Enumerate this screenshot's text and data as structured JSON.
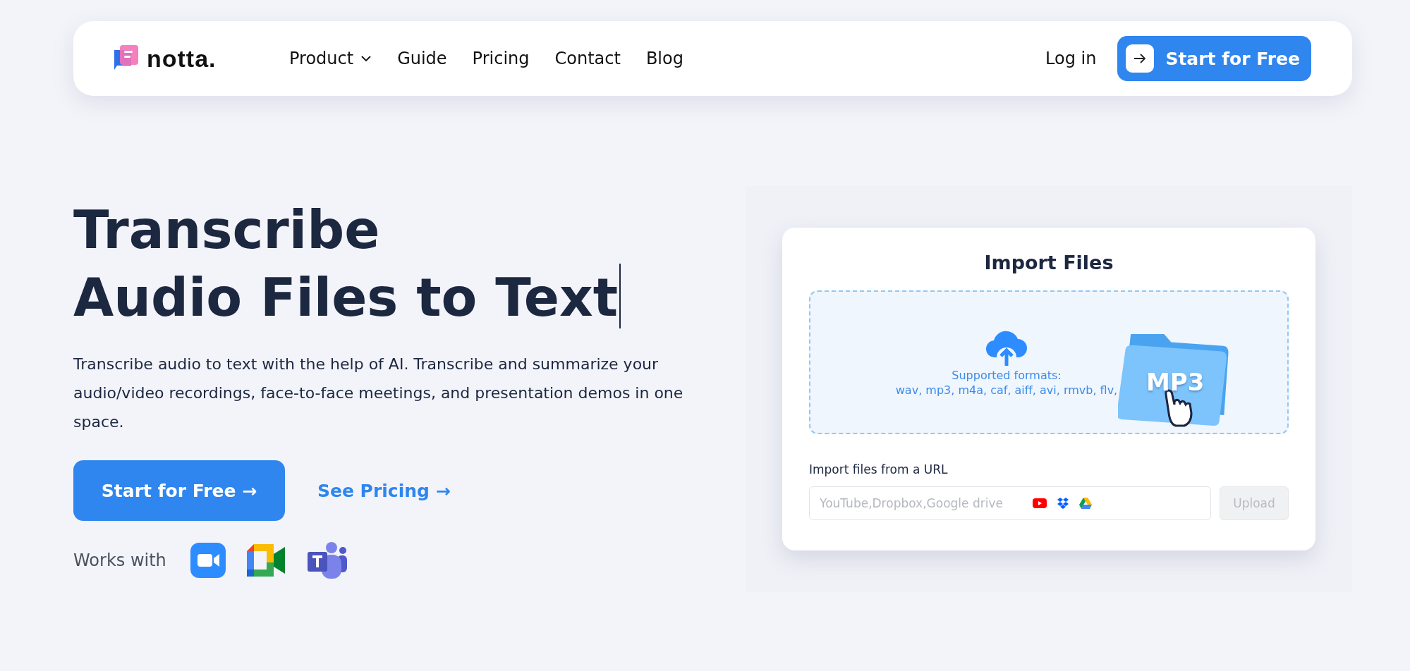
{
  "nav": {
    "logo": "notta.",
    "links": [
      {
        "label": "Product",
        "dropdown": true
      },
      {
        "label": "Guide",
        "dropdown": false
      },
      {
        "label": "Pricing",
        "dropdown": false
      },
      {
        "label": "Contact",
        "dropdown": false
      },
      {
        "label": "Blog",
        "dropdown": false
      }
    ],
    "login": "Log in",
    "cta": "Start for Free"
  },
  "hero": {
    "title_lines": [
      "Transcribe",
      "Audio Files to Text"
    ],
    "text_cursor": true,
    "description": "Transcribe audio to text with the help of AI. Transcribe and summarize your audio/video recordings, face-to-face meetings, and presentation demos in one space.",
    "primary_button": "Start for Free →",
    "secondary_link": "See Pricing →",
    "works_with": "Works with"
  },
  "import_card": {
    "title": "Import Files",
    "formats_label": "Supported formats:",
    "formats": "wav, mp3, m4a, caf, aiff, avi, rmvb, flv,",
    "folder_label": "MP3",
    "url_label": "Import files from a URL",
    "url_placeholder": "YouTube,Dropbox,Google drive",
    "upload_button": "Upload",
    "upload_disabled": true
  }
}
